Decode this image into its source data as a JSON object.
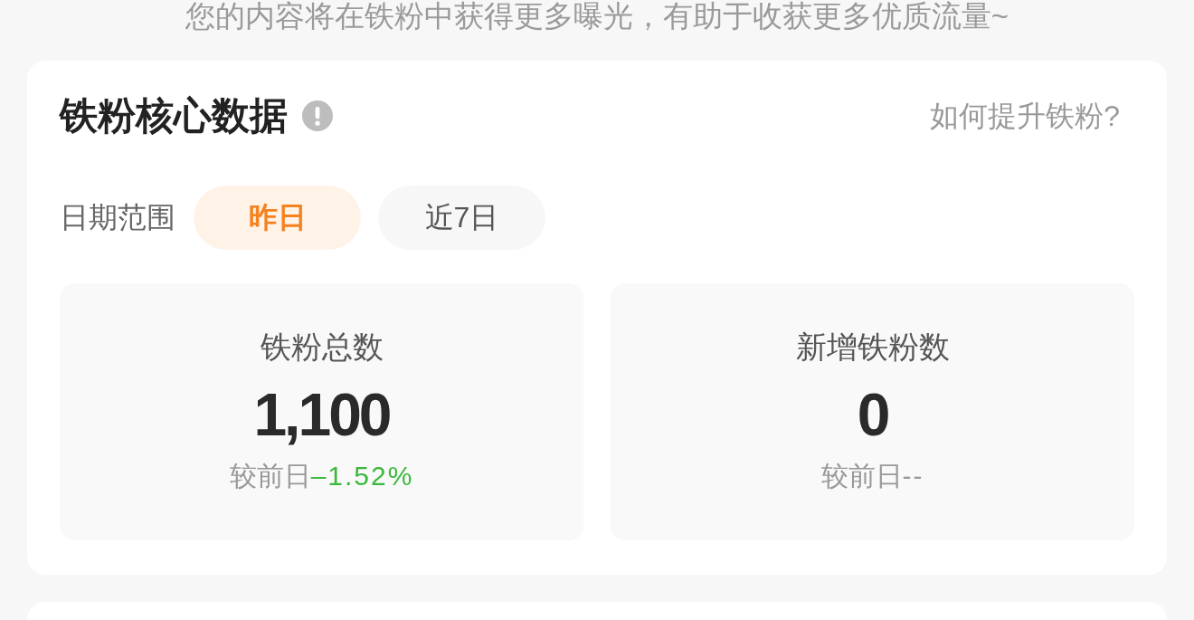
{
  "intro_text": "您的内容将在铁粉中获得更多曝光，有助于收获更多优质流量~",
  "core_data_card": {
    "title": "铁粉核心数据",
    "help_link": "如何提升铁粉?",
    "date_range": {
      "label": "日期范围",
      "options": [
        {
          "label": "昨日",
          "selected": true
        },
        {
          "label": "近7日",
          "selected": false
        }
      ]
    },
    "stats": [
      {
        "label": "铁粉总数",
        "value": "1,100",
        "comparison_label": "较前日",
        "change": "–1.52%",
        "color": "#3cb83c"
      },
      {
        "label": "新增铁粉数",
        "value": "0",
        "comparison_label": "较前日",
        "change": "--",
        "color": "#999999"
      }
    ]
  }
}
